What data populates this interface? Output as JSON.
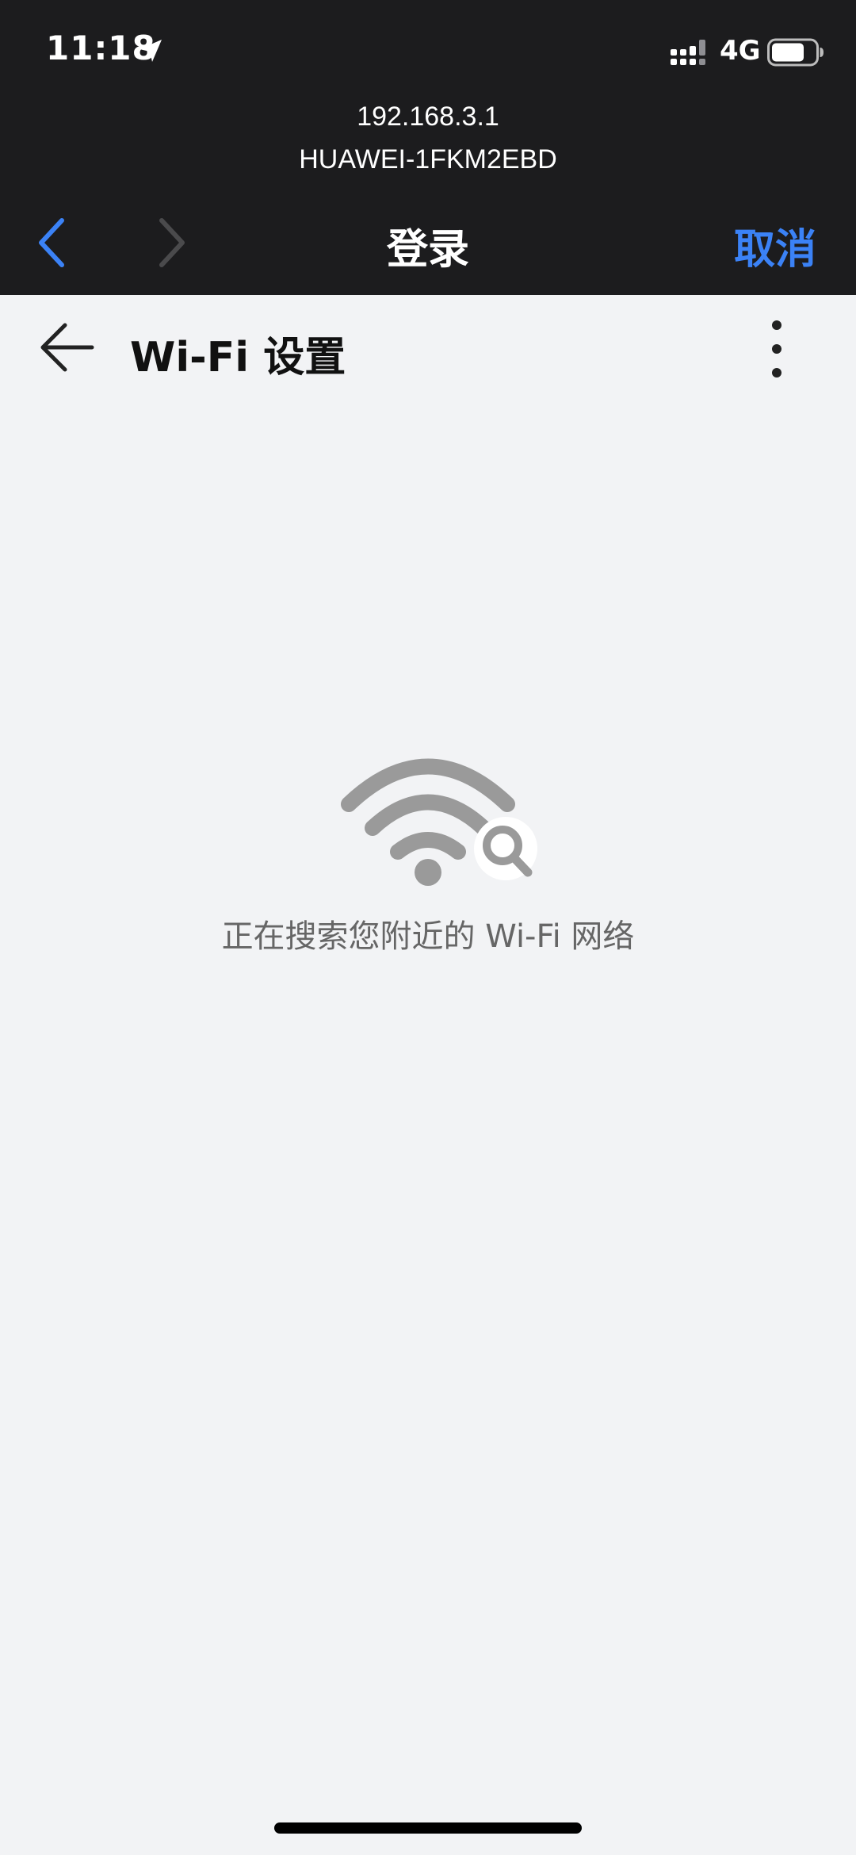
{
  "status_bar": {
    "time": "11:18",
    "network": "4G",
    "icons": [
      "location-arrow-icon",
      "signal-icon",
      "battery-icon"
    ]
  },
  "portal": {
    "host": "192.168.3.1",
    "ssid": "HUAWEI-1FKM2EBD",
    "title": "登录",
    "cancel_label": "取消",
    "icons": [
      "chevron-left-icon",
      "chevron-right-icon"
    ]
  },
  "app_bar": {
    "title": "Wi-Fi 设置",
    "icons": [
      "arrow-left-icon",
      "more-vertical-icon"
    ]
  },
  "content": {
    "icon": "wifi-search-icon",
    "message": "正在搜索您附近的 Wi-Fi 网络"
  },
  "colors": {
    "dark_header": "#1C1C1E",
    "background": "#F2F3F5",
    "accent": "#3B82F6",
    "icon_gray": "#9A9A9A",
    "message_text": "#666666"
  }
}
